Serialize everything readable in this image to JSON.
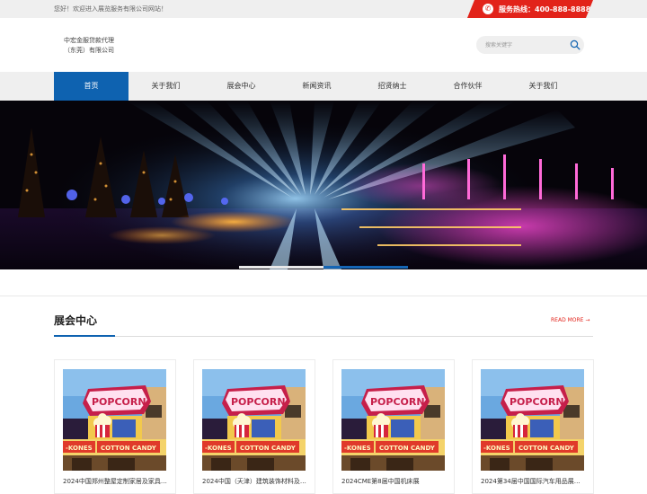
{
  "topbar": {
    "welcome": "您好！欢迎进入展览服务有限公司网站！",
    "hotline_label": "服务热线：400-888-8888",
    "hotline_color": "#e2231a"
  },
  "header": {
    "logo_line1": "中宏金服贷款代理",
    "logo_line2": "（东莞）有限公司",
    "search_placeholder": "搜索关键字"
  },
  "nav": {
    "items": [
      {
        "label": "首页",
        "active": true
      },
      {
        "label": "关于我们"
      },
      {
        "label": "展会中心"
      },
      {
        "label": "新闻资讯"
      },
      {
        "label": "招贤纳士"
      },
      {
        "label": "合作伙伴"
      },
      {
        "label": "关于我们"
      }
    ],
    "accent": "#0e62b0"
  },
  "banner": {
    "slide_count": 2,
    "active_slide": 2
  },
  "section": {
    "title": "展会中心",
    "read_more": "READ MORE →"
  },
  "cards": [
    {
      "caption": "2024中国郑州整屋定制家居及家具…"
    },
    {
      "caption": "2024中国（天津）建筑装饰材料及…"
    },
    {
      "caption": "2024CME第8届中国机床展"
    },
    {
      "caption": "2024第34届中国国际汽车用品展…"
    }
  ]
}
